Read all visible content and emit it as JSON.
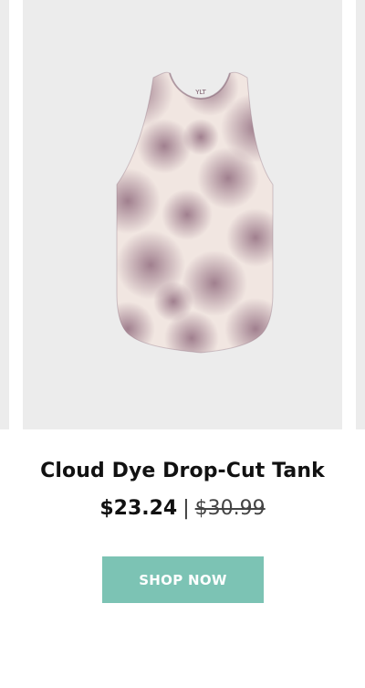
{
  "product": {
    "image": "tie-dye-tank-top-image",
    "label_text": "YLT",
    "name": "Cloud Dye Drop-Cut Tank",
    "price_current": "$23.24",
    "price_separator": "|",
    "price_original": "$30.99",
    "cta_label": "SHOP NOW"
  },
  "colors": {
    "card_bg": "#ececec",
    "cta_bg": "#7cc3b4",
    "dye_mauve": "#9c7a8a",
    "dye_cream": "#f1e6e1"
  }
}
